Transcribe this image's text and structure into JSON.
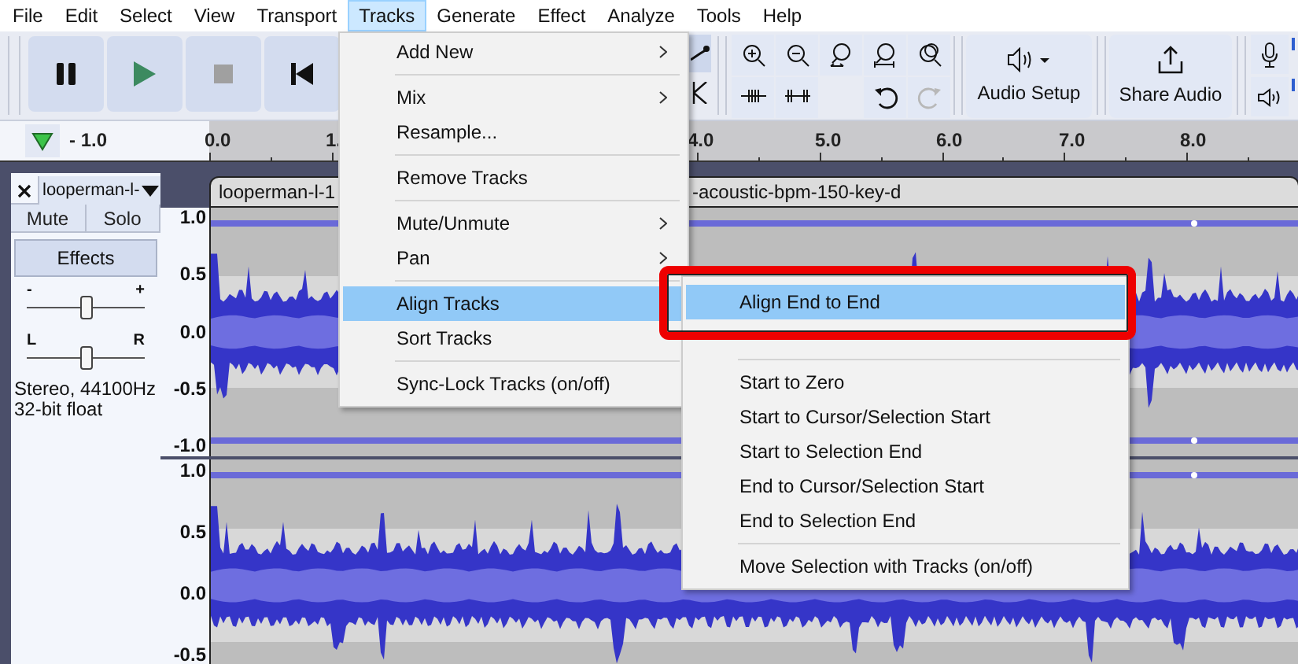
{
  "menu_bar": [
    {
      "label": "File",
      "selected": false
    },
    {
      "label": "Edit",
      "selected": false
    },
    {
      "label": "Select",
      "selected": false
    },
    {
      "label": "View",
      "selected": false
    },
    {
      "label": "Transport",
      "selected": false
    },
    {
      "label": "Tracks",
      "selected": true
    },
    {
      "label": "Generate",
      "selected": false
    },
    {
      "label": "Effect",
      "selected": false
    },
    {
      "label": "Analyze",
      "selected": false
    },
    {
      "label": "Tools",
      "selected": false
    },
    {
      "label": "Help",
      "selected": false
    }
  ],
  "toolbar": {
    "audio_setup": "Audio Setup",
    "share_audio": "Share Audio"
  },
  "ruler": {
    "ticks": [
      "- 1.0",
      "0.0",
      "1.",
      "4.0",
      "5.0",
      "6.0",
      "7.0",
      "8.0"
    ]
  },
  "track": {
    "name": "looperman-l-",
    "buttons": [
      "Mute",
      "Solo"
    ],
    "effects": "Effects",
    "gain": {
      "minus": "-",
      "plus": "+",
      "level": 0.5
    },
    "pan": {
      "left": "L",
      "right": "R",
      "level": 0.5
    },
    "info": [
      "Stereo, 44100Hz",
      "32-bit float"
    ],
    "clip_title_parts": [
      "looperman-l-1",
      "-acoustic-bpm-150-key-d"
    ],
    "channels": [
      {
        "scale": [
          "1.0",
          "0.5",
          "0.0",
          "-0.5",
          "-1.0"
        ]
      },
      {
        "scale": [
          "1.0",
          "0.5",
          "0.0",
          "-0.5"
        ]
      }
    ]
  },
  "tracks_menu": {
    "groups": [
      [
        {
          "label": "Add New",
          "has_submenu": true,
          "selected": false
        }
      ],
      [
        {
          "label": "Mix",
          "has_submenu": true,
          "selected": false
        },
        {
          "label": "Resample...",
          "has_submenu": false,
          "selected": false
        }
      ],
      [
        {
          "label": "Remove Tracks",
          "has_submenu": false,
          "selected": false
        }
      ],
      [
        {
          "label": "Mute/Unmute",
          "has_submenu": true,
          "selected": false
        },
        {
          "label": "Pan",
          "has_submenu": true,
          "selected": false
        }
      ],
      [
        {
          "label": "Align Tracks",
          "has_submenu": true,
          "selected": true
        },
        {
          "label": "Sort Tracks",
          "has_submenu": false,
          "selected": false
        }
      ],
      [
        {
          "label": "Sync-Lock Tracks (on/off)",
          "has_submenu": false,
          "selected": false
        }
      ]
    ]
  },
  "align_submenu": {
    "groups": [
      [
        {
          "label": "Align End to End",
          "selected": true
        }
      ],
      [
        {
          "label": "Start to Zero",
          "selected": false
        },
        {
          "label": "Start to Cursor/Selection Start",
          "selected": false
        },
        {
          "label": "Start to Selection End",
          "selected": false
        },
        {
          "label": "End to Cursor/Selection Start",
          "selected": false
        },
        {
          "label": "End to Selection End",
          "selected": false
        }
      ],
      [
        {
          "label": "Move Selection with Tracks (on/off)",
          "selected": false
        }
      ]
    ]
  }
}
